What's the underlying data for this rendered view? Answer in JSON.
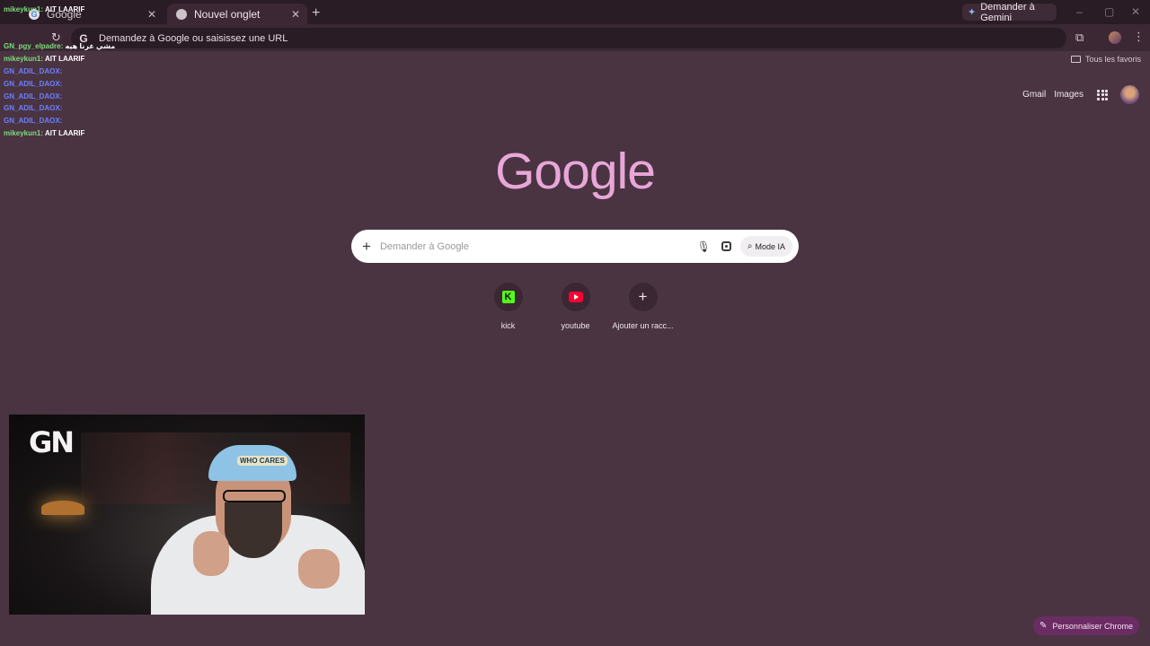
{
  "tabs": [
    {
      "title": "Google",
      "active": false
    },
    {
      "title": "Nouvel onglet",
      "active": true
    }
  ],
  "gemini_button": "Demander à Gemini",
  "omnibox": {
    "placeholder": "Demandez à Google ou saisissez une URL"
  },
  "bookmarks": {
    "all_favorites": "Tous les favoris"
  },
  "top_links": {
    "gmail": "Gmail",
    "images": "Images"
  },
  "logo_text": "Google",
  "search": {
    "placeholder": "Demander à Google",
    "mode_ia": "Mode IA"
  },
  "shortcuts": [
    {
      "label": "kick",
      "icon": "kick-icon"
    },
    {
      "label": "youtube",
      "icon": "youtube-icon"
    },
    {
      "label": "Ajouter un racc...",
      "icon": "plus-icon"
    }
  ],
  "chat": [
    {
      "user": "mikeykun1:",
      "msg": "AIT LAARIF"
    },
    {
      "user": "GN_pgy_elpadre:",
      "msg": "مشي غرنا هيه"
    },
    {
      "user": "mikeykun1:",
      "msg": "AIT LAARIF"
    },
    {
      "user": "GN_ADIL_DAOX:",
      "msg": ""
    },
    {
      "user": "GN_ADIL_DAOX:",
      "msg": ""
    },
    {
      "user": "GN_ADIL_DAOX:",
      "msg": ""
    },
    {
      "user": "GN_ADIL_DAOX:",
      "msg": ""
    },
    {
      "user": "GN_ADIL_DAOX:",
      "msg": ""
    },
    {
      "user": "mikeykun1:",
      "msg": "AIT LAARIF"
    }
  ],
  "webcam": {
    "logo": "GN",
    "cap_text": "WHO CARES"
  },
  "customize_button": "Personnaliser Chrome",
  "colors": {
    "background": "#4a3442",
    "tabstrip": "#2a1c25",
    "logo": "#e8a6d9",
    "customize_bg": "#6a2c63"
  }
}
